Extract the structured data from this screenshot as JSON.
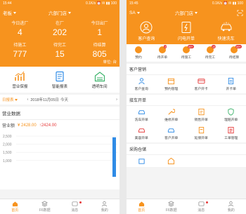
{
  "colors": {
    "accent": "#f7931e",
    "alert": "#e63c3c",
    "blue": "#2f8be6"
  },
  "left": {
    "status": {
      "time": "15:44",
      "icons": "0.1K/s ⏰ ✉ ▮▮ 100"
    },
    "topbar": {
      "left_label": "老板",
      "center_label": "六部门店"
    },
    "stats": [
      {
        "label": "今日进厂",
        "value": "4"
      },
      {
        "label": "在厂",
        "value": "202"
      },
      {
        "label": "今日出厂",
        "value": "1"
      },
      {
        "label": "待施工",
        "value": "777"
      },
      {
        "label": "待完工",
        "value": "15"
      },
      {
        "label": "待结算",
        "value": "805"
      }
    ],
    "unit": "单位: 台",
    "quick": [
      {
        "label": "营业保报",
        "icon": "chart-up-icon"
      },
      {
        "label": "智能报表",
        "icon": "report-icon"
      },
      {
        "label": "透明车间",
        "icon": "garage-icon"
      }
    ],
    "datebar": {
      "selector": "日报表",
      "prev": "‹",
      "date": "2018年11月05日",
      "next": "›",
      "today": "今天"
    },
    "card": {
      "title": "营业数据",
      "legend_key": "营业额",
      "value_a": "¥ 2428.00",
      "value_b": "↑2424.00"
    },
    "chart_data": {
      "type": "bar",
      "categories": [
        "",
        "",
        "",
        "",
        "",
        "",
        ""
      ],
      "values": [
        0,
        0,
        0,
        0,
        0,
        0,
        2428
      ],
      "yticks": [
        "2,500",
        "2,000",
        "1,500",
        "1,000"
      ],
      "ylim": [
        0,
        2500
      ]
    },
    "tabs": [
      {
        "label": "首页",
        "icon": "home-icon",
        "active": true
      },
      {
        "label": "F6数据",
        "icon": "layers-icon",
        "active": false
      },
      {
        "label": "消息",
        "icon": "message-icon",
        "active": false,
        "dot": true
      },
      {
        "label": "我的",
        "icon": "user-icon",
        "active": false
      }
    ]
  },
  "right": {
    "status": {
      "time": "15:45",
      "icons": "0.1K/s ⏰ ✉ ▮▮ 100"
    },
    "topbar": {
      "left_label": "SA",
      "center_label": "六部门店"
    },
    "hero": [
      {
        "label": "客户查询",
        "icon": "customer-search-icon"
      },
      {
        "label": "闪电开单",
        "icon": "flash-order-icon"
      },
      {
        "label": "快速洗车",
        "icon": "car-wash-icon"
      }
    ],
    "badges": [
      {
        "label": "预约",
        "count": ""
      },
      {
        "label": "待开单",
        "count": "3"
      },
      {
        "label": "待施工",
        "count": "99+"
      },
      {
        "label": "待完工",
        "count": "15"
      },
      {
        "label": "待结算",
        "count": "99+"
      }
    ],
    "sections": [
      {
        "title": "客户营销",
        "items": [
          {
            "label": "客户查询",
            "icon": "person-icon"
          },
          {
            "label": "预约管理",
            "icon": "calendar-icon"
          },
          {
            "label": "客户开卡",
            "icon": "card-icon"
          },
          {
            "label": "开卡单",
            "icon": "clipboard-icon"
          }
        ]
      },
      {
        "title": "接车开单",
        "items": [
          {
            "label": "洗车开单",
            "icon": "wash-icon"
          },
          {
            "label": "维修开单",
            "icon": "wrench-icon"
          },
          {
            "label": "销售开单",
            "icon": "sale-icon"
          },
          {
            "label": "理赔开单",
            "icon": "shield-icon"
          }
        ]
      },
      {
        "title": "",
        "items": [
          {
            "label": "美容开单",
            "icon": "beauty-icon"
          },
          {
            "label": "客户开单",
            "icon": "car-icon"
          },
          {
            "label": "延保开单",
            "icon": "doc-icon"
          },
          {
            "label": "工单管理",
            "icon": "list-icon"
          }
        ]
      },
      {
        "title": "采购仓储",
        "items": [
          {
            "label": "",
            "icon": "box-icon"
          },
          {
            "label": "",
            "icon": "warehouse-icon"
          }
        ]
      }
    ],
    "tabs": [
      {
        "label": "首页",
        "icon": "home-icon",
        "active": true
      },
      {
        "label": "F6数据",
        "icon": "layers-icon",
        "active": false
      },
      {
        "label": "消息",
        "icon": "message-icon",
        "active": false,
        "dot": true
      },
      {
        "label": "我的",
        "icon": "user-icon",
        "active": false
      }
    ]
  }
}
